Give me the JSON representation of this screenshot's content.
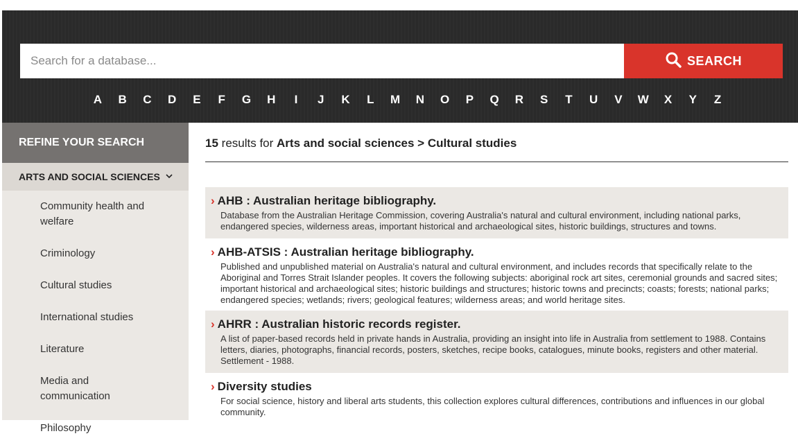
{
  "search": {
    "placeholder": "Search for a database...",
    "button_label": "SEARCH"
  },
  "alphabet": [
    "A",
    "B",
    "C",
    "D",
    "E",
    "F",
    "G",
    "H",
    "I",
    "J",
    "K",
    "L",
    "M",
    "N",
    "O",
    "P",
    "Q",
    "R",
    "S",
    "T",
    "U",
    "V",
    "W",
    "X",
    "Y",
    "Z"
  ],
  "sidebar": {
    "refine_label": "REFINE YOUR SEARCH",
    "category_label": "ARTS AND SOCIAL SCIENCES",
    "subcategories": [
      "Community health and welfare",
      "Criminology",
      "Cultural studies",
      "International studies",
      "Literature",
      "Media and communication",
      "Philosophy"
    ]
  },
  "results": {
    "count": "15",
    "for_text": "results for",
    "category_path": "Arts and social sciences > Cultural studies",
    "items": [
      {
        "title": "AHB : Australian heritage bibliography.",
        "description": "Database from the Australian Heritage Commission, covering Australia's natural and cultural environment, including national parks, endangered species, wilderness areas, important historical and archaeological sites, historic buildings, structures and towns."
      },
      {
        "title": "AHB-ATSIS : Australian heritage bibliography.",
        "description": "Published and unpublished material on Australia's natural and cultural environment, and includes records that specifically relate to the Aboriginal and Torres Strait Islander peoples. It covers the following subjects: aboriginal rock art sites, ceremonial grounds and sacred sites; important historical and archaeological sites; historic buildings and structures; historic towns and precincts; coasts; forests; national parks; endangered species; wetlands; rivers; geological features; wilderness areas; and world heritage sites."
      },
      {
        "title": "AHRR : Australian historic records register.",
        "description": "A list of paper-based records held in private hands in Australia, providing an insight into life in Australia from settlement to 1988. Contains letters, diaries, photographs, financial records, posters, sketches, recipe books, catalogues, minute books, registers and other material. Settlement - 1988."
      },
      {
        "title": "Diversity studies",
        "description": "For social science, history and liberal arts students, this collection explores cultural differences, contributions and influences in our global community."
      }
    ]
  }
}
